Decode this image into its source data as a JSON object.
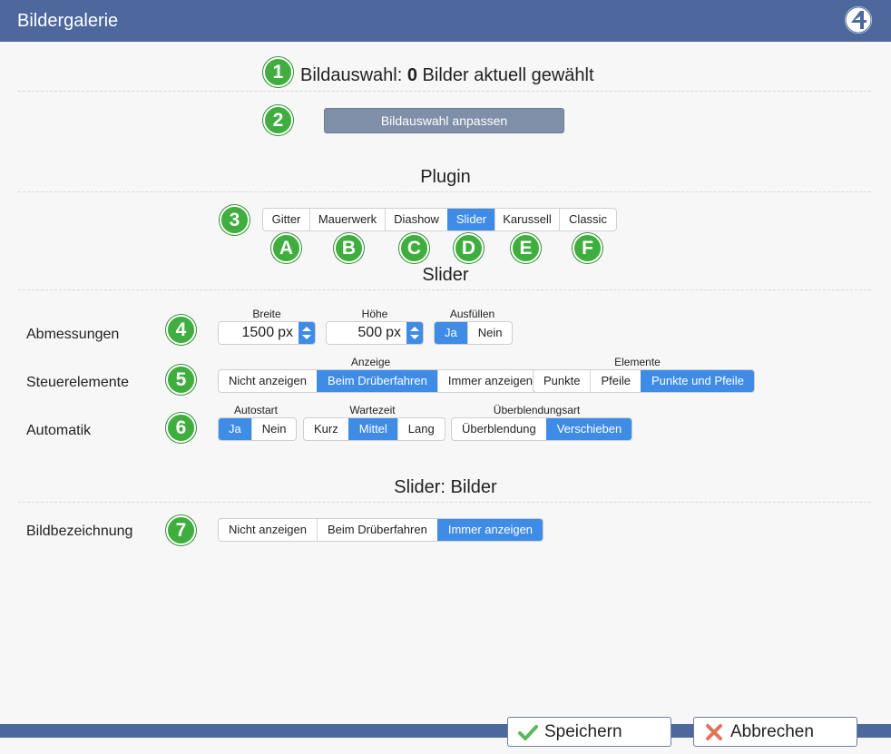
{
  "window": {
    "title": "Bildergalerie",
    "logo_icon": "four-logo-icon"
  },
  "selection": {
    "badge": "1",
    "label_prefix": "Bildauswahl:",
    "count": "0",
    "label_suffix": "Bilder aktuell gewählt",
    "adjust_badge": "2",
    "adjust_button": "Bildauswahl anpassen"
  },
  "plugin": {
    "heading": "Plugin",
    "badge": "3",
    "options": [
      "Gitter",
      "Mauerwerk",
      "Diashow",
      "Slider",
      "Karussell",
      "Classic"
    ],
    "selected": "Slider",
    "option_badges": [
      "A",
      "B",
      "C",
      "D",
      "E",
      "F"
    ]
  },
  "slider": {
    "heading": "Slider",
    "dimensions": {
      "label": "Abmessungen",
      "badge": "4",
      "width_label": "Breite",
      "width_value": "1500",
      "height_label": "Höhe",
      "height_value": "500",
      "unit": "px",
      "fill_label": "Ausfüllen",
      "fill_options": [
        "Ja",
        "Nein"
      ],
      "fill_selected": "Ja"
    },
    "controls": {
      "label": "Steuerelemente",
      "badge": "5",
      "display_label": "Anzeige",
      "display_options": [
        "Nicht anzeigen",
        "Beim Drüberfahren",
        "Immer anzeigen"
      ],
      "display_selected": "Beim Drüberfahren",
      "elements_label": "Elemente",
      "elements_options": [
        "Punkte",
        "Pfeile",
        "Punkte und Pfeile"
      ],
      "elements_selected": "Punkte und Pfeile"
    },
    "automatic": {
      "label": "Automatik",
      "badge": "6",
      "autostart_label": "Autostart",
      "autostart_options": [
        "Ja",
        "Nein"
      ],
      "autostart_selected": "Ja",
      "wait_label": "Wartezeit",
      "wait_options": [
        "Kurz",
        "Mittel",
        "Lang"
      ],
      "wait_selected": "Mittel",
      "transition_label": "Überblendungsart",
      "transition_options": [
        "Überblendung",
        "Verschieben"
      ],
      "transition_selected": "Verschieben"
    }
  },
  "images": {
    "heading": "Slider: Bilder",
    "caption": {
      "label": "Bildbezeichnung",
      "badge": "7",
      "options": [
        "Nicht anzeigen",
        "Beim Drüberfahren",
        "Immer anzeigen"
      ],
      "selected": "Immer anzeigen"
    }
  },
  "footer": {
    "save": "Speichern",
    "save_icon": "checkmark-icon",
    "cancel": "Abbrechen",
    "cancel_icon": "cross-icon"
  },
  "colors": {
    "titlebar": "#4d689c",
    "badge_green": "#3fae3f",
    "active_blue": "#3f8ce6"
  }
}
